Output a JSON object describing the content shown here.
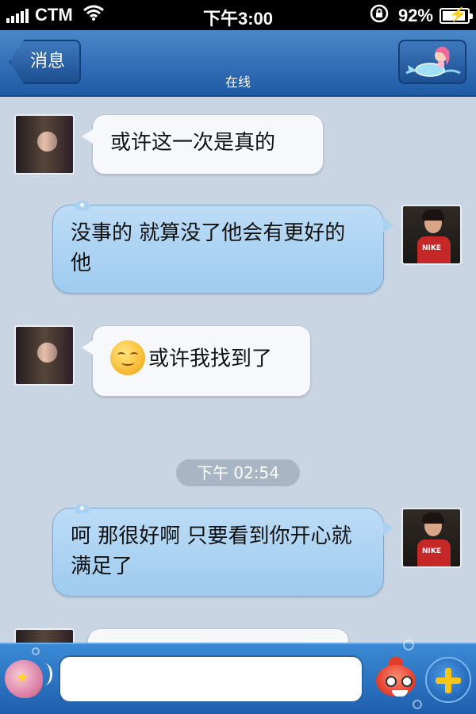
{
  "status_bar": {
    "carrier": "CTM",
    "time": "下午3:00",
    "battery": "92%",
    "battery_level": 0.92,
    "icons": [
      "signal-icon",
      "wifi-icon",
      "orientation-lock-icon",
      "battery-charging-icon"
    ]
  },
  "nav": {
    "back_label": "消息",
    "subtitle": "在线",
    "right_icon": "mermaid-icon",
    "accent": "#1f5aa5"
  },
  "messages": [
    {
      "side": "in",
      "avatar": "girl",
      "text": "或许这一次是真的"
    },
    {
      "side": "out",
      "avatar": "boy",
      "text": "没事的 就算没了他会有更好的他"
    },
    {
      "side": "in",
      "avatar": "girl",
      "emoji": "smile-emoji",
      "text": "或许我找到了"
    },
    {
      "side": "out",
      "avatar": "boy",
      "text": "呵 那很好啊 只要看到你开心就满足了"
    },
    {
      "side": "in",
      "avatar": "girl",
      "text": ""
    }
  ],
  "timestamp": "下午 02:54",
  "toolbar": {
    "input_value": "",
    "voice_icon": "shell-voice-icon",
    "emoji_icon": "fish-emoji-icon",
    "more_icon": "plus-icon"
  }
}
